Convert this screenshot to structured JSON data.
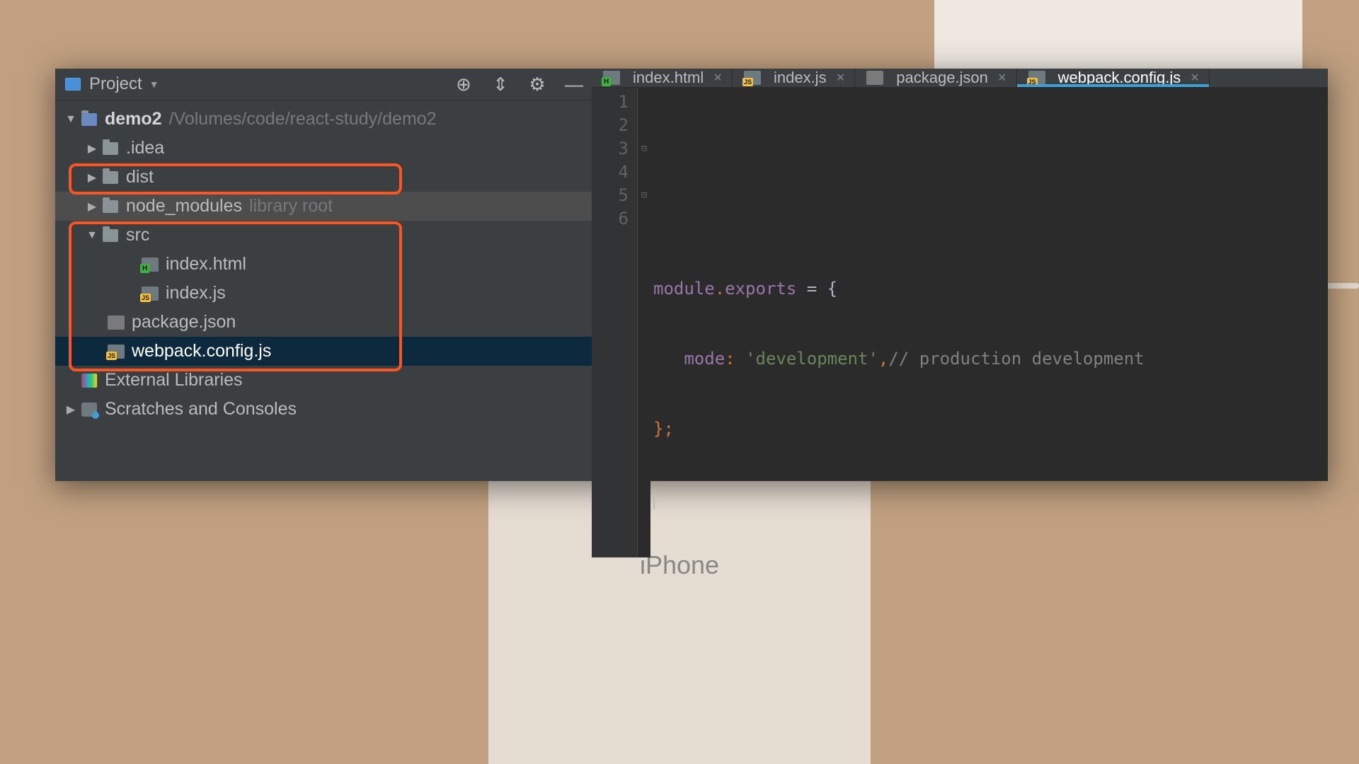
{
  "panel": {
    "title": "Project"
  },
  "project": {
    "root_name": "demo2",
    "root_path": "/Volumes/code/react-study/demo2",
    "folders": {
      "idea": ".idea",
      "dist": "dist",
      "node_modules": "node_modules",
      "node_modules_hint": "library root",
      "src": "src"
    },
    "files": {
      "index_html": "index.html",
      "index_js": "index.js",
      "package_json": "package.json",
      "webpack_config": "webpack.config.js"
    },
    "external_libraries": "External Libraries",
    "scratches": "Scratches and Consoles"
  },
  "tabs": [
    {
      "name": "index.html",
      "type": "html",
      "active": false
    },
    {
      "name": "index.js",
      "type": "js",
      "active": false
    },
    {
      "name": "package.json",
      "type": "json",
      "active": false
    },
    {
      "name": "webpack.config.js",
      "type": "js",
      "active": true
    }
  ],
  "editor": {
    "lines": [
      "1",
      "2",
      "3",
      "4",
      "5",
      "6"
    ],
    "line3_module": "module",
    "line3_exports": "exports",
    "line3_rest": " = {",
    "line4_key": "mode",
    "line4_str": "'development'",
    "line4_comment": "// production development",
    "line5": "};"
  }
}
